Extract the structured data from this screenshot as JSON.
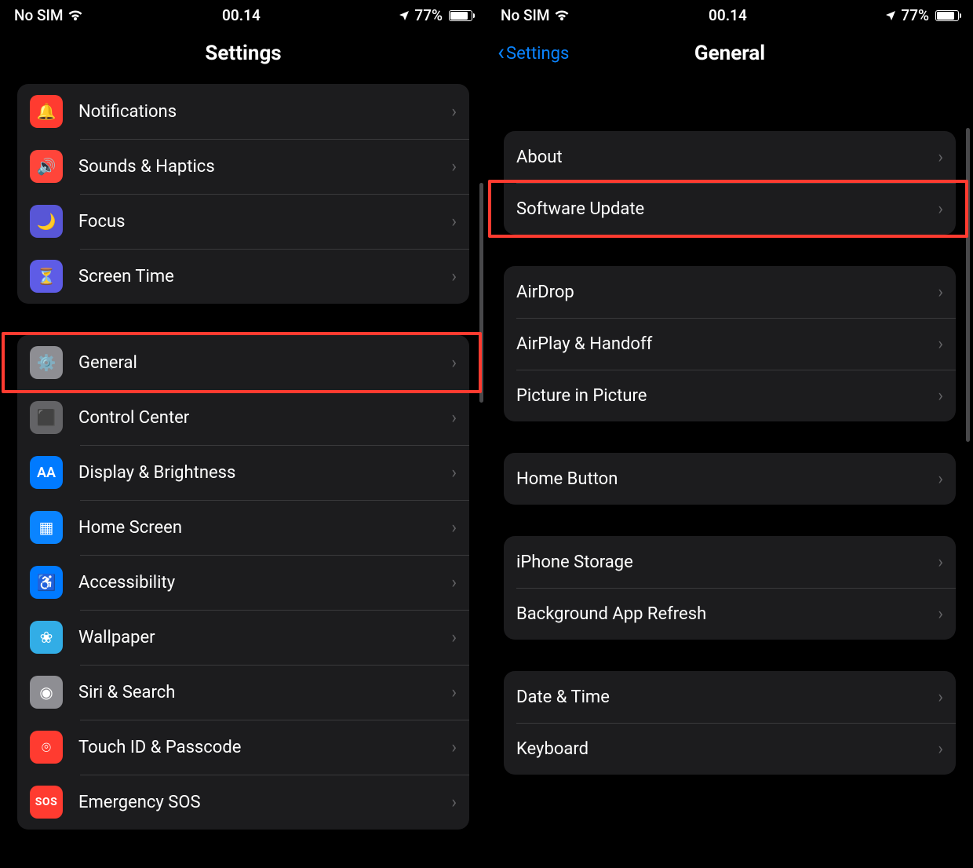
{
  "left": {
    "status": {
      "carrier": "No SIM",
      "time": "00.14",
      "battery": "77%"
    },
    "title": "Settings",
    "group1": {
      "items": [
        {
          "label": "Notifications",
          "name": "notifications",
          "color": "bg-red",
          "glyph": "🔔"
        },
        {
          "label": "Sounds & Haptics",
          "name": "sounds-haptics",
          "color": "bg-red2",
          "glyph": "🔊"
        },
        {
          "label": "Focus",
          "name": "focus",
          "color": "bg-purple",
          "glyph": "🌙"
        },
        {
          "label": "Screen Time",
          "name": "screen-time",
          "color": "bg-darkblue",
          "glyph": "⏳"
        }
      ]
    },
    "group2": {
      "items": [
        {
          "label": "General",
          "name": "general",
          "color": "bg-gray",
          "glyph": "⚙️",
          "highlight": true
        },
        {
          "label": "Control Center",
          "name": "control-center",
          "color": "bg-gray2",
          "glyph": "⬛"
        },
        {
          "label": "Display & Brightness",
          "name": "display-brightness",
          "color": "bg-blue",
          "glyph": "AA"
        },
        {
          "label": "Home Screen",
          "name": "home-screen",
          "color": "bg-blue2",
          "glyph": "▦"
        },
        {
          "label": "Accessibility",
          "name": "accessibility",
          "color": "bg-blue",
          "glyph": "♿"
        },
        {
          "label": "Wallpaper",
          "name": "wallpaper",
          "color": "bg-teal",
          "glyph": "❀"
        },
        {
          "label": "Siri & Search",
          "name": "siri-search",
          "color": "bg-gray",
          "glyph": "◉"
        },
        {
          "label": "Touch ID & Passcode",
          "name": "touch-id",
          "color": "bg-touch",
          "glyph": "⌾"
        },
        {
          "label": "Emergency SOS",
          "name": "emergency-sos",
          "color": "bg-sos",
          "glyph": "SOS",
          "isSOS": true
        }
      ]
    }
  },
  "right": {
    "status": {
      "carrier": "No SIM",
      "time": "00.14",
      "battery": "77%"
    },
    "back": "Settings",
    "title": "General",
    "group1": {
      "items": [
        {
          "label": "About",
          "name": "about"
        },
        {
          "label": "Software Update",
          "name": "software-update",
          "highlight": true
        }
      ]
    },
    "group2": {
      "items": [
        {
          "label": "AirDrop",
          "name": "airdrop"
        },
        {
          "label": "AirPlay & Handoff",
          "name": "airplay-handoff"
        },
        {
          "label": "Picture in Picture",
          "name": "picture-in-picture"
        }
      ]
    },
    "group3": {
      "items": [
        {
          "label": "Home Button",
          "name": "home-button"
        }
      ]
    },
    "group4": {
      "items": [
        {
          "label": "iPhone Storage",
          "name": "iphone-storage"
        },
        {
          "label": "Background App Refresh",
          "name": "background-app-refresh"
        }
      ]
    },
    "group5": {
      "items": [
        {
          "label": "Date & Time",
          "name": "date-time"
        },
        {
          "label": "Keyboard",
          "name": "keyboard"
        }
      ]
    }
  }
}
